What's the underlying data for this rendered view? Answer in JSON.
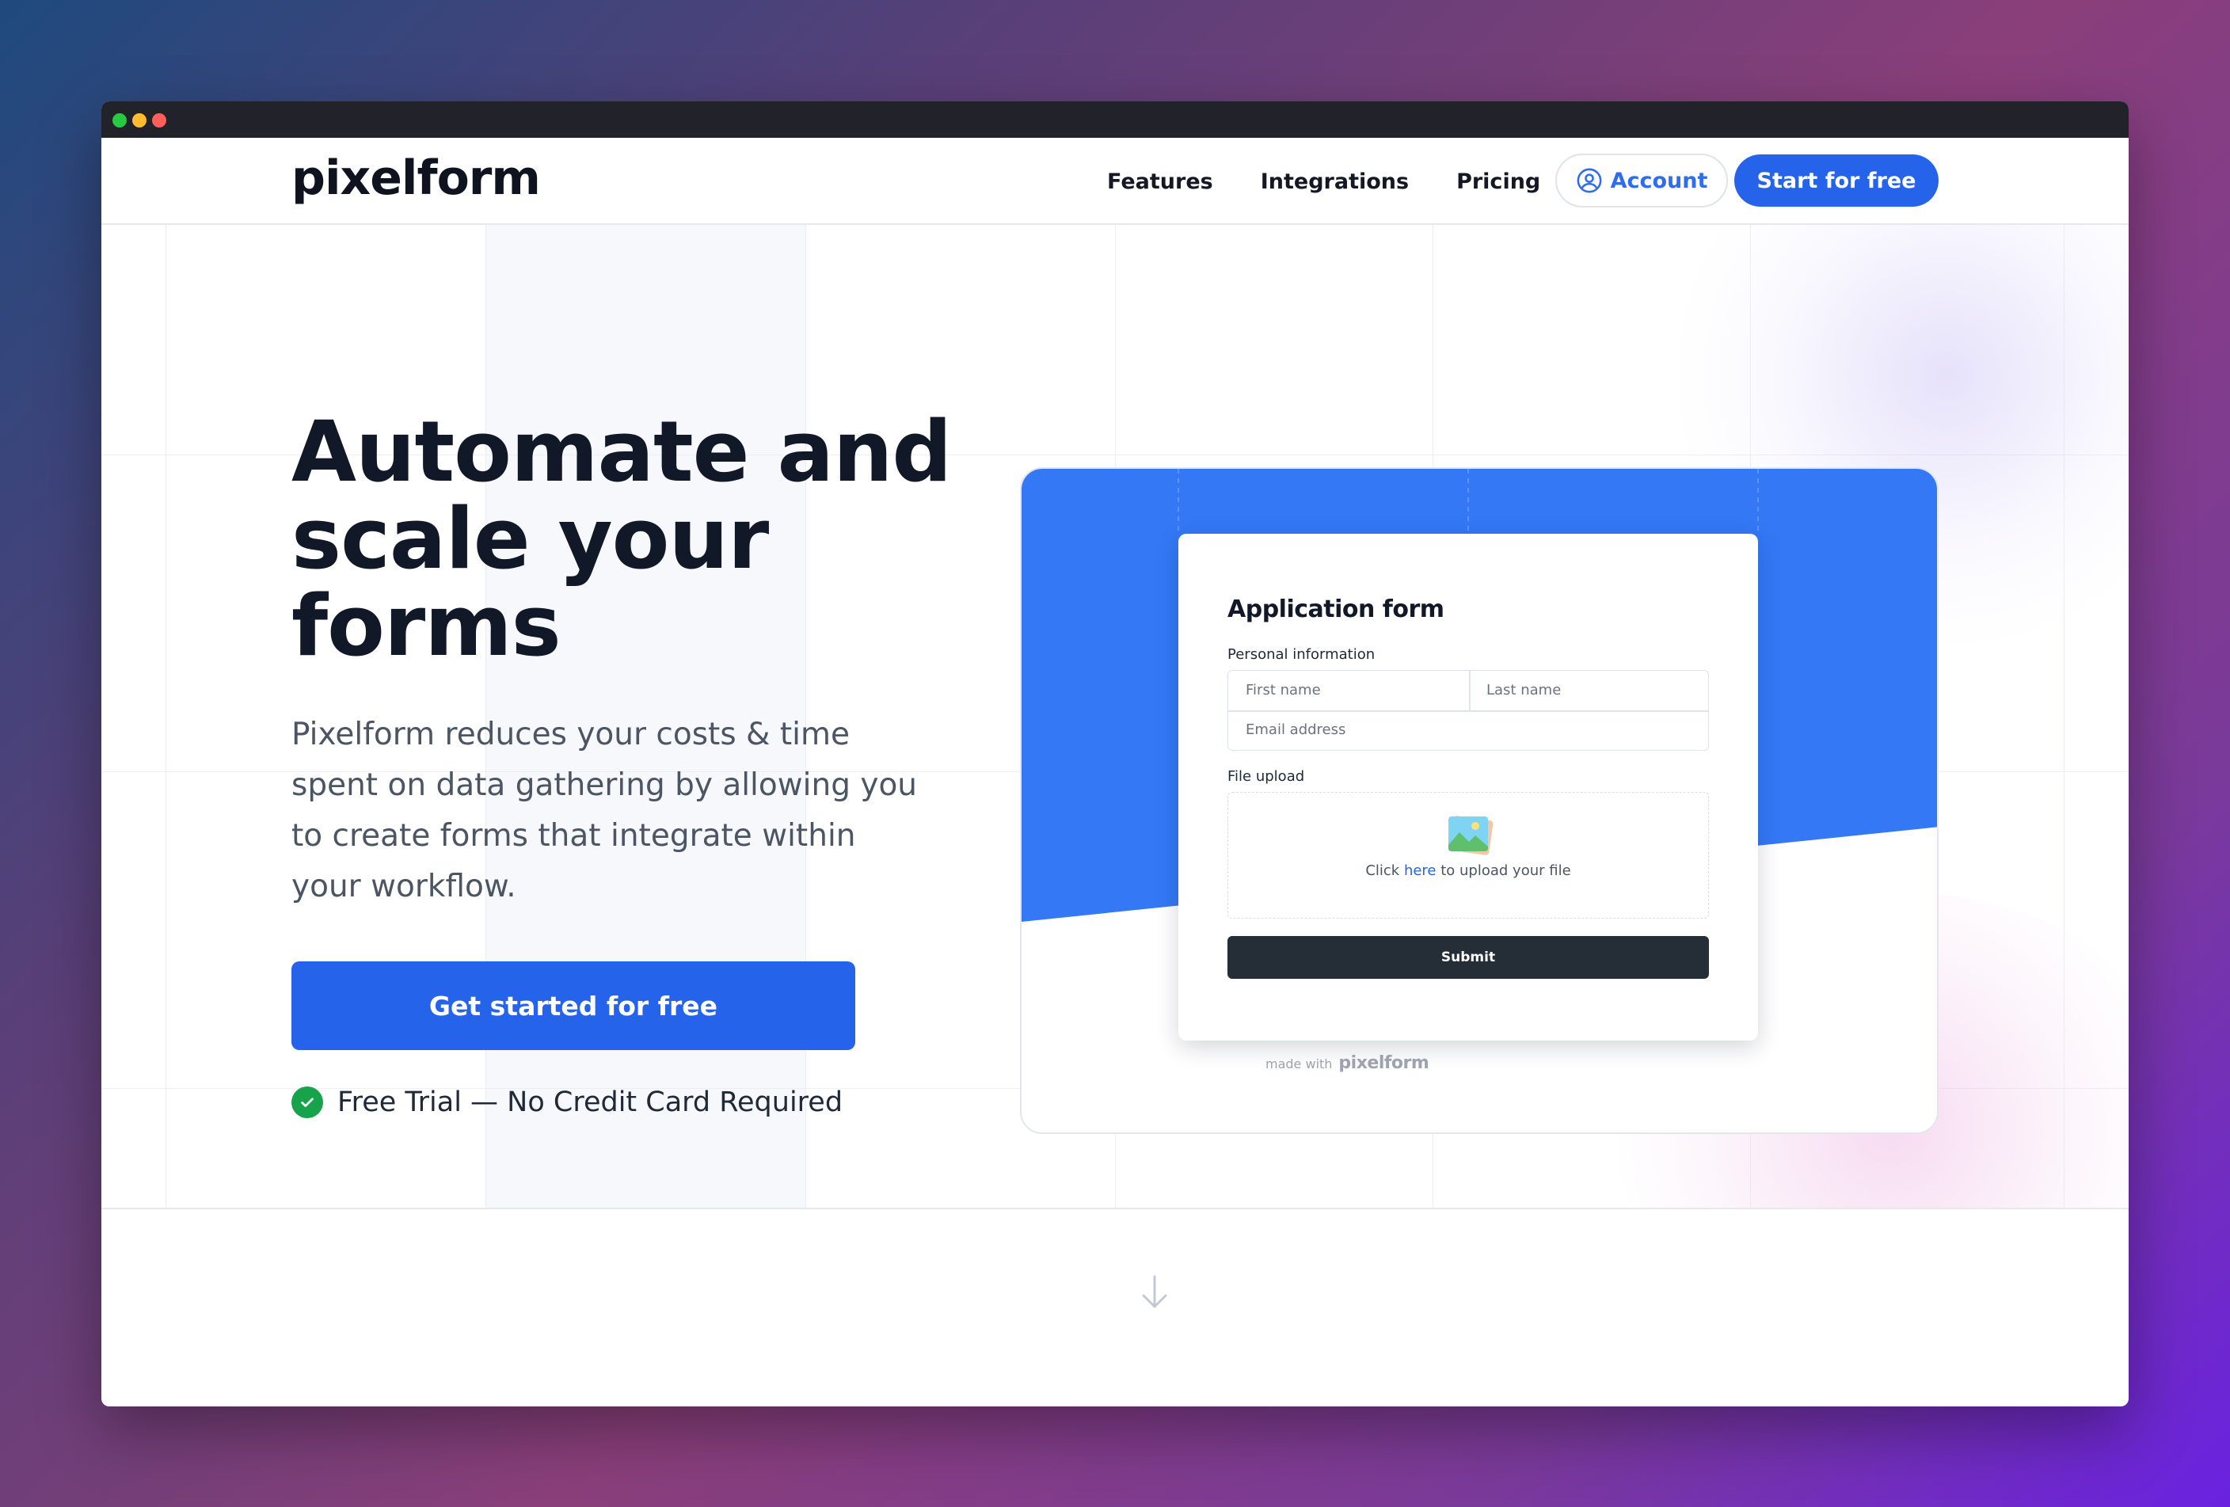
{
  "window": {
    "traffic_lights": [
      "green",
      "yellow",
      "red"
    ]
  },
  "nav": {
    "logo": "pixelform",
    "links": [
      "Features",
      "Integrations",
      "Pricing"
    ],
    "account_label": "Account",
    "start_label": "Start for free"
  },
  "hero": {
    "headline": "Automate and scale your forms",
    "subtext": "Pixelform reduces your costs & time spent on data gathering by allowing you to create forms that integrate within your workflow.",
    "cta_label": "Get started for free",
    "trial_note": "Free Trial — No Credit Card Required"
  },
  "form_preview": {
    "title": "Application form",
    "personal_label": "Personal information",
    "first_name_placeholder": "First name",
    "last_name_placeholder": "Last name",
    "email_placeholder": "Email address",
    "upload_label": "File upload",
    "upload_prefix": "Click",
    "upload_link": "here",
    "upload_suffix": "to upload your file",
    "submit_label": "Submit",
    "made_with": "made with",
    "made_with_brand": "pixelform"
  },
  "colors": {
    "primary": "#2563eb",
    "preview_blue": "#3478f6",
    "headline": "#111827",
    "success": "#16a34a",
    "submit_dark": "#252d36"
  },
  "icons": [
    "user-circle-icon",
    "check-circle-icon",
    "image-icon",
    "arrow-down-icon"
  ]
}
